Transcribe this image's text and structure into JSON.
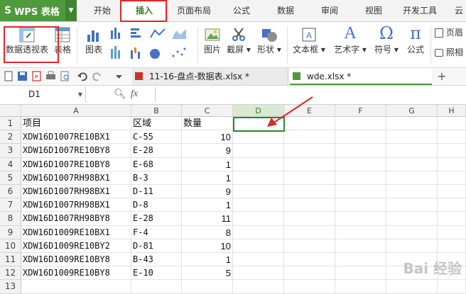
{
  "app": {
    "title": "WPS 表格"
  },
  "tabs": [
    "开始",
    "插入",
    "页面布局",
    "公式",
    "数据",
    "审阅",
    "视图",
    "开发工具",
    "云"
  ],
  "ribbon": {
    "pivot_label": "数据透视表",
    "table_label": "表格",
    "chart_label": "图表",
    "picture_label": "图片",
    "screenshot_label": "截屏 ▾",
    "shape_label": "形状 ▾",
    "textbox_label": "文本框 ▾",
    "wordart_label": "艺术字 ▾",
    "symbol_label": "符号 ▾",
    "formula_label": "公式",
    "header_label": "页眉",
    "camera_label": "照相"
  },
  "doc_tabs": [
    {
      "label": "11-16-盘点-数据表.xlsx *"
    },
    {
      "label": "wde.xlsx *"
    }
  ],
  "formula_bar": {
    "name_box": "D1",
    "fx": "fx"
  },
  "columns": [
    "A",
    "B",
    "C",
    "D",
    "E",
    "F",
    "G",
    "H"
  ],
  "rows": [
    {
      "n": "1",
      "a": "项目",
      "b": "区域",
      "c": "数量"
    },
    {
      "n": "2",
      "a": "XDW16D1007RE10BX1",
      "b": "C-55",
      "c": "10"
    },
    {
      "n": "3",
      "a": "XDW16D1007RE10BY8",
      "b": "E-28",
      "c": "9"
    },
    {
      "n": "4",
      "a": "XDW16D1007RE10BY8",
      "b": "E-68",
      "c": "1"
    },
    {
      "n": "5",
      "a": "XDW16D1007RH98BX1",
      "b": "B-3",
      "c": "1"
    },
    {
      "n": "6",
      "a": "XDW16D1007RH98BX1",
      "b": "D-11",
      "c": "9"
    },
    {
      "n": "7",
      "a": "XDW16D1007RH98BX1",
      "b": "D-8",
      "c": "1"
    },
    {
      "n": "8",
      "a": "XDW16D1007RH98BY8",
      "b": "E-28",
      "c": "11"
    },
    {
      "n": "9",
      "a": "XDW16D1009RE10BX1",
      "b": "F-4",
      "c": "8"
    },
    {
      "n": "10",
      "a": "XDW16D1009RE10BY2",
      "b": "D-81",
      "c": "10"
    },
    {
      "n": "11",
      "a": "XDW16D1009RE10BY8",
      "b": "B-43",
      "c": "1"
    },
    {
      "n": "12",
      "a": "XDW16D1009RE10BY8",
      "b": "E-10",
      "c": "5"
    },
    {
      "n": "13",
      "a": "",
      "b": "",
      "c": ""
    }
  ],
  "colors": {
    "accent": "#4e9a3c",
    "highlight": "#e0262a",
    "selection": "#2f8a2f"
  },
  "watermark": "Bai 经验"
}
